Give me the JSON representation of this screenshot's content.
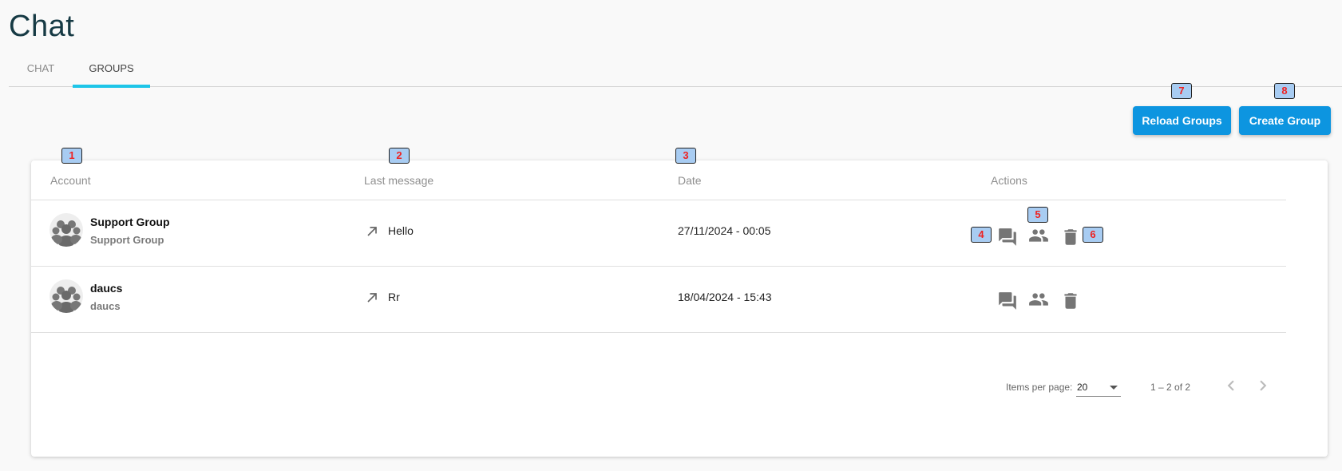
{
  "page": {
    "title": "Chat"
  },
  "tabs": [
    {
      "label": "CHAT",
      "active": false
    },
    {
      "label": "GROUPS",
      "active": true
    }
  ],
  "toolbar": {
    "reload_label": "Reload Groups",
    "create_label": "Create Group"
  },
  "table": {
    "headers": {
      "account": "Account",
      "last_message": "Last message",
      "date": "Date",
      "actions": "Actions"
    },
    "rows": [
      {
        "account_name": "Support Group",
        "account_sub": "Support Group",
        "last_message": "Hello",
        "date": "27/11/2024 - 00:05",
        "actions": [
          "chat-icon",
          "group-icon",
          "delete-icon"
        ]
      },
      {
        "account_name": "daucs",
        "account_sub": "daucs",
        "last_message": "Rr",
        "date": "18/04/2024 - 15:43",
        "actions": [
          "chat-icon",
          "group-icon",
          "delete-icon"
        ]
      }
    ]
  },
  "paginator": {
    "items_per_page_label": "Items per page:",
    "items_per_page_value": "20",
    "range_label": "1 – 2 of 2"
  },
  "badges": {
    "b1": "1",
    "b2": "2",
    "b3": "3",
    "b4": "4",
    "b5": "5",
    "b6": "6",
    "b7": "7",
    "b8": "8"
  },
  "colors": {
    "accent": "#0d95e0",
    "tab_indicator": "#1ec5e8",
    "icon": "#757575",
    "badge_bg": "#a8ccf2",
    "badge_text": "#e22222"
  }
}
